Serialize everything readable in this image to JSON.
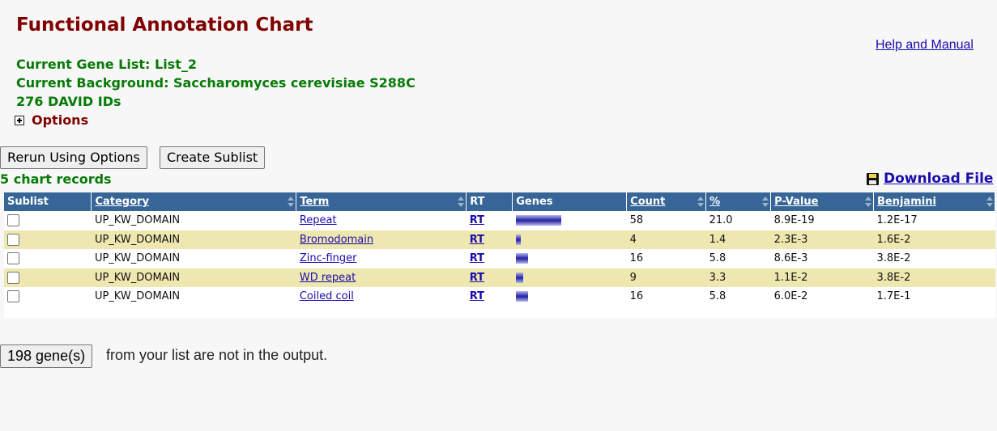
{
  "header": {
    "title": "Functional Annotation Chart",
    "help_link": "Help and Manual",
    "gene_list": "Current Gene List: List_2",
    "background": "Current Background: Saccharomyces cerevisiae S288C",
    "david_ids": "276 DAVID IDs",
    "options_label": "Options"
  },
  "actions": {
    "rerun_label": "Rerun Using Options",
    "sublist_label": "Create Sublist",
    "records_text": "5 chart records",
    "download_label": "Download File"
  },
  "table": {
    "headers": [
      "Sublist",
      "Category",
      "Term",
      "RT",
      "Genes",
      "Count",
      "%",
      "P-Value",
      "Benjamini"
    ],
    "rows": [
      {
        "category": "UP_KW_DOMAIN",
        "term": "Repeat",
        "rt": "RT",
        "count": "58",
        "percent": "21.0",
        "pvalue": "8.9E-19",
        "benjamini": "1.2E-17",
        "genes_fraction": 1.0
      },
      {
        "category": "UP_KW_DOMAIN",
        "term": "Bromodomain",
        "rt": "RT",
        "count": "4",
        "percent": "1.4",
        "pvalue": "2.3E-3",
        "benjamini": "1.6E-2",
        "genes_fraction": 0.069
      },
      {
        "category": "UP_KW_DOMAIN",
        "term": "Zinc-finger",
        "rt": "RT",
        "count": "16",
        "percent": "5.8",
        "pvalue": "8.6E-3",
        "benjamini": "3.8E-2",
        "genes_fraction": 0.276
      },
      {
        "category": "UP_KW_DOMAIN",
        "term": "WD repeat",
        "rt": "RT",
        "count": "9",
        "percent": "3.3",
        "pvalue": "1.1E-2",
        "benjamini": "3.8E-2",
        "genes_fraction": 0.155
      },
      {
        "category": "UP_KW_DOMAIN",
        "term": "Coiled coil",
        "rt": "RT",
        "count": "16",
        "percent": "5.8",
        "pvalue": "6.0E-2",
        "benjamini": "1.7E-1",
        "genes_fraction": 0.276
      }
    ]
  },
  "footer": {
    "genes_button": "198 gene(s)",
    "genes_text": "from your list are not in the output."
  },
  "colors": {
    "title": "#800000",
    "info": "#067a06",
    "header_bg": "#376597",
    "alt_row": "#efe7b0",
    "link": "#1a0dab"
  }
}
